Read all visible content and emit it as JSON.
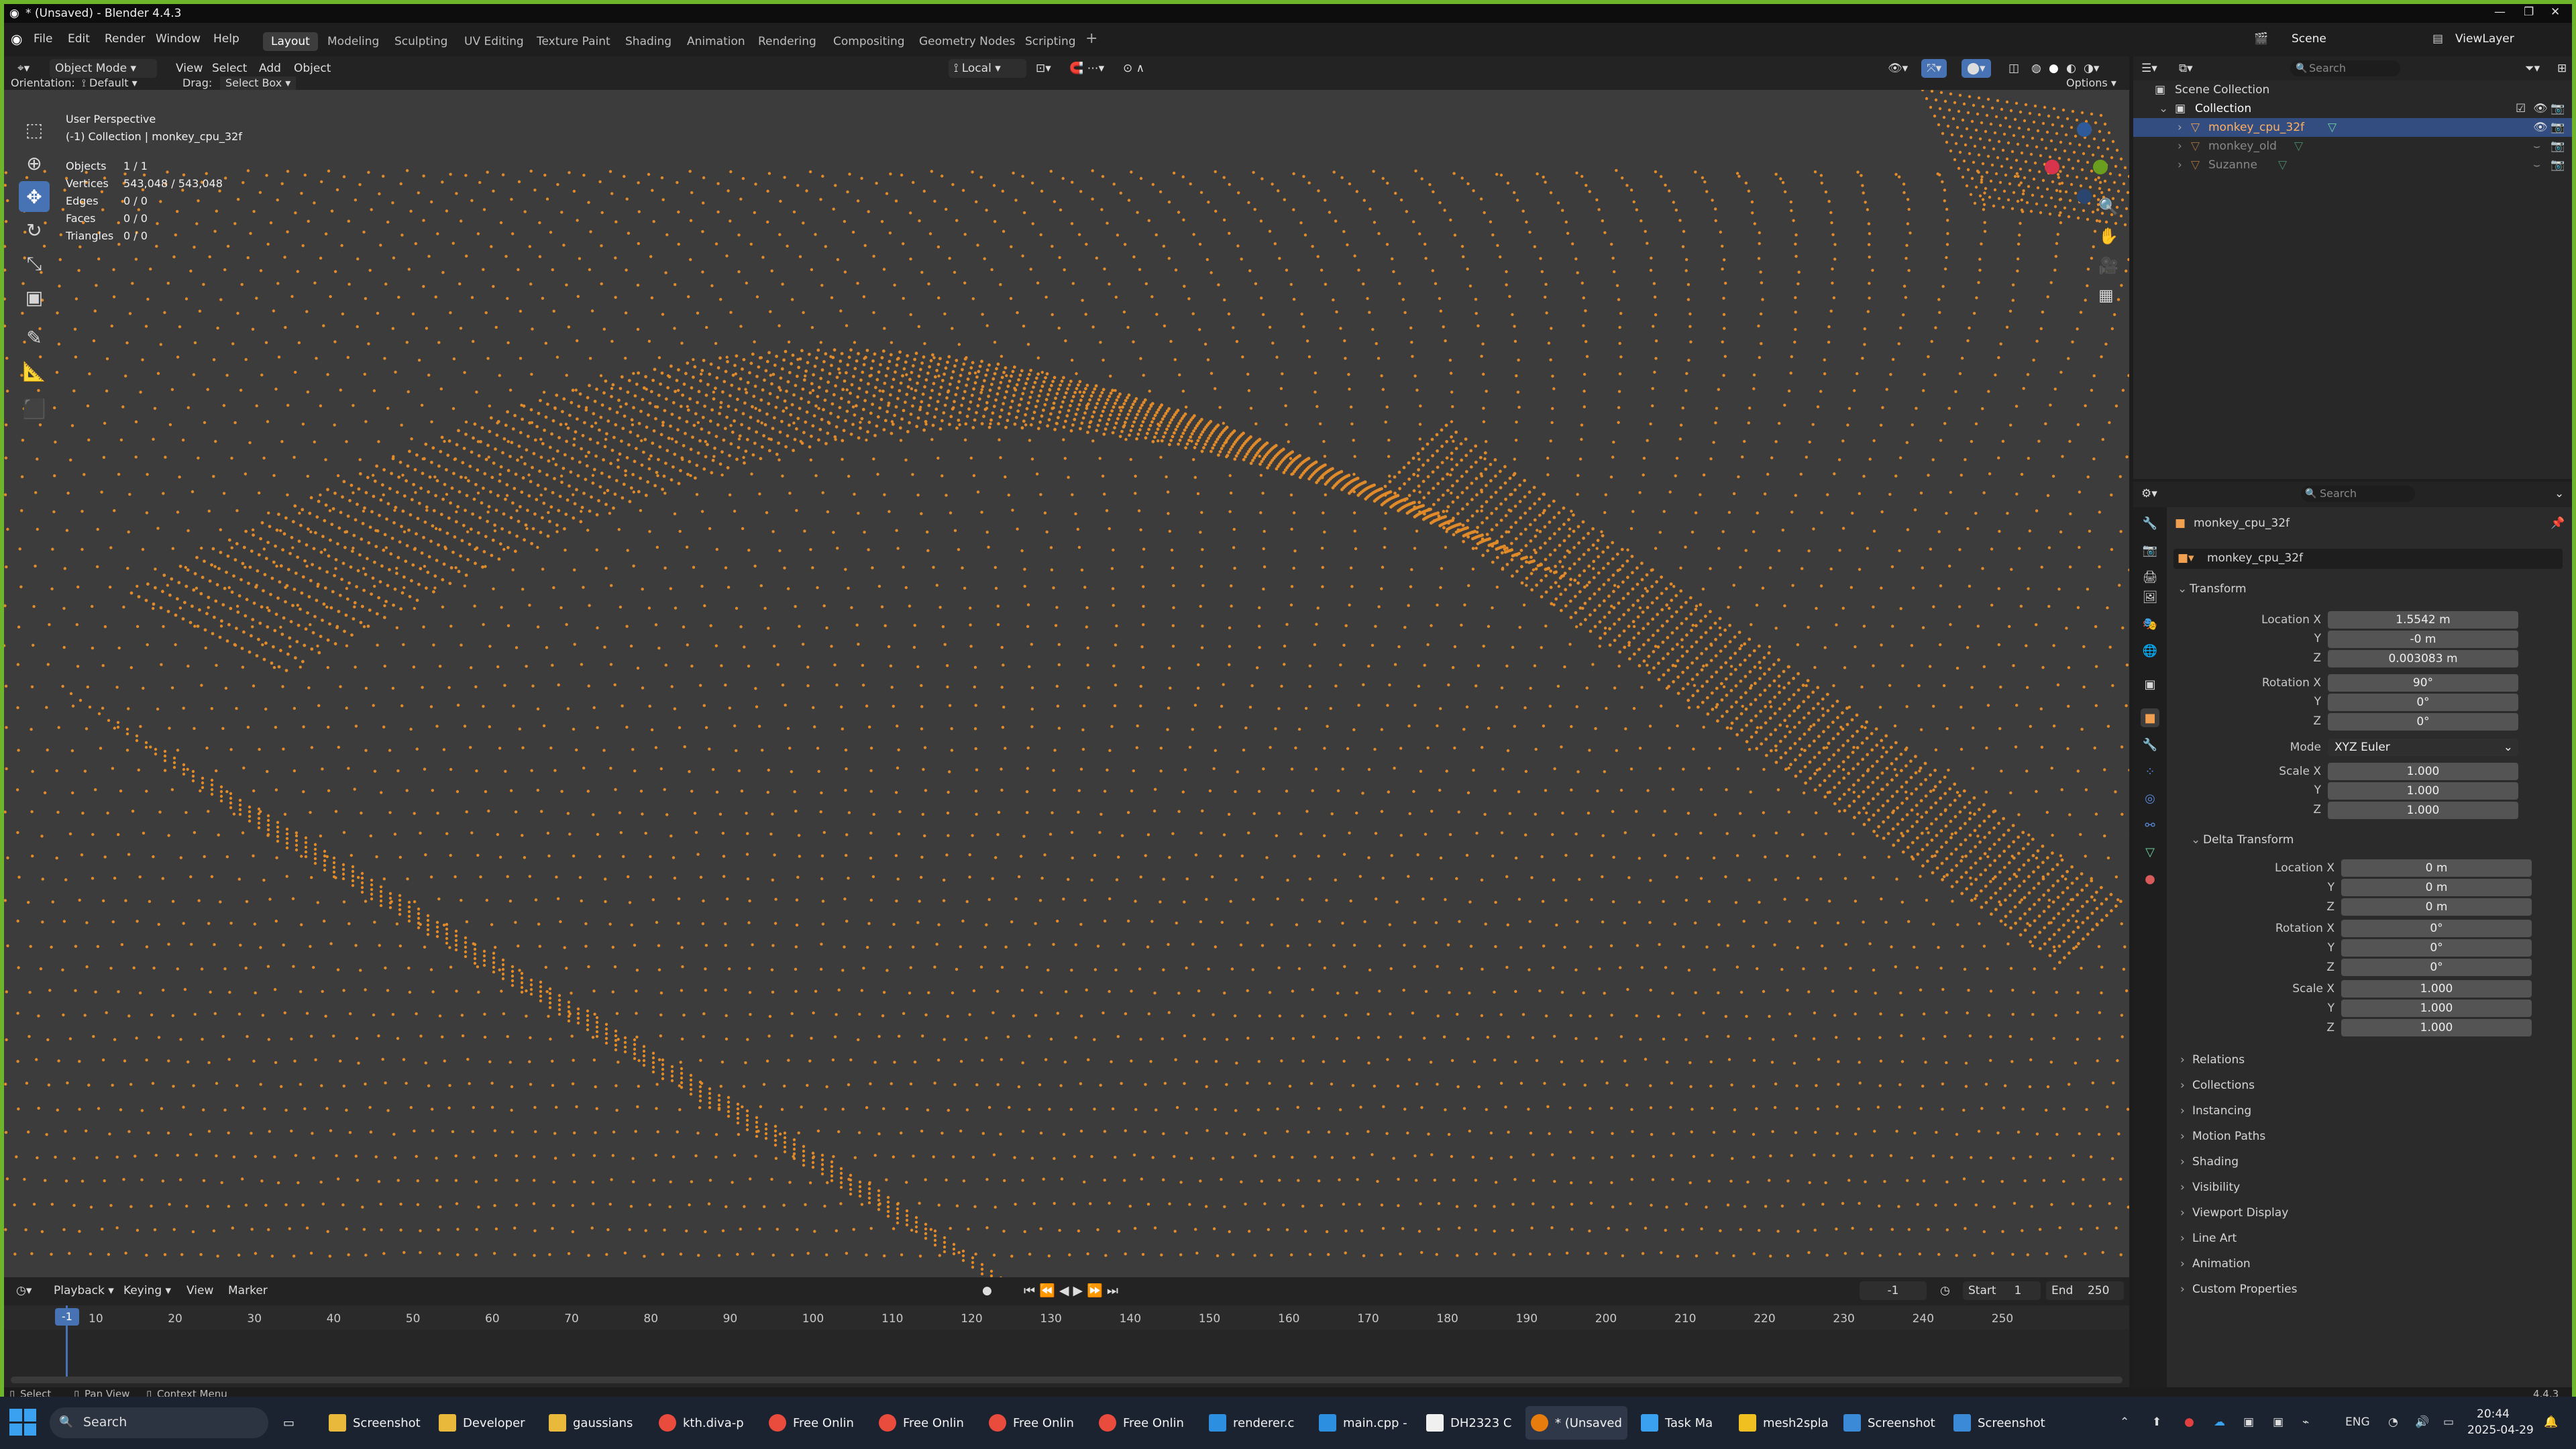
{
  "titlebar": {
    "title": "* (Unsaved) - Blender 4.4.3"
  },
  "menu": [
    "File",
    "Edit",
    "Render",
    "Window",
    "Help"
  ],
  "workspaces": [
    "Layout",
    "Modeling",
    "Sculpting",
    "UV Editing",
    "Texture Paint",
    "Shading",
    "Animation",
    "Rendering",
    "Compositing",
    "Geometry Nodes",
    "Scripting"
  ],
  "active_workspace": "Layout",
  "scene": {
    "label": "Scene",
    "viewlayer": "ViewLayer"
  },
  "viewport_header": {
    "mode": "Object Mode",
    "menus": [
      "View",
      "Select",
      "Add",
      "Object"
    ],
    "transform_orientation": "Local",
    "orientation_label": "Orientation:",
    "orientation_value": "Default",
    "drag_label": "Drag:",
    "drag_value": "Select Box",
    "options": "Options"
  },
  "viewport_info": {
    "perspective": "User Perspective",
    "collection": "(-1) Collection | monkey_cpu_32f",
    "stats": [
      {
        "label": "Objects",
        "value": "1 / 1"
      },
      {
        "label": "Vertices",
        "value": "543,048 / 543,048"
      },
      {
        "label": "Edges",
        "value": "0 / 0"
      },
      {
        "label": "Faces",
        "value": "0 / 0"
      },
      {
        "label": "Triangles",
        "value": "0 / 0"
      }
    ]
  },
  "point_color": "#e08a2a",
  "timeline": {
    "menus": [
      "Playback",
      "Keying",
      "View",
      "Marker"
    ],
    "current_frame": "-1",
    "start_label": "Start",
    "start": "1",
    "end_label": "End",
    "end": "250",
    "ticks": [
      "-1",
      "10",
      "20",
      "30",
      "40",
      "50",
      "60",
      "70",
      "80",
      "90",
      "100",
      "110",
      "120",
      "130",
      "140",
      "150",
      "160",
      "170",
      "180",
      "190",
      "200",
      "210",
      "220",
      "230",
      "240",
      "250"
    ]
  },
  "statusbar": {
    "select": "Select",
    "pan": "Pan View",
    "context": "Context Menu",
    "version": "4.4.3"
  },
  "outliner": {
    "search_placeholder": "Search",
    "scene_collection": "Scene Collection",
    "collection": "Collection",
    "objects": [
      {
        "name": "monkey_cpu_32f",
        "selected": true
      },
      {
        "name": "monkey_old",
        "selected": false
      },
      {
        "name": "Suzanne",
        "selected": false
      }
    ]
  },
  "properties": {
    "search_placeholder": "Search",
    "object_name": "monkey_cpu_32f",
    "data_name": "monkey_cpu_32f",
    "transform_title": "Transform",
    "location": {
      "label_x": "Location X",
      "x": "1.5542 m",
      "y": "-0 m",
      "z": "0.003083 m"
    },
    "rotation": {
      "label_x": "Rotation X",
      "x": "90°",
      "y": "0°",
      "z": "0°"
    },
    "mode_label": "Mode",
    "mode_value": "XYZ Euler",
    "scale": {
      "label_x": "Scale X",
      "x": "1.000",
      "y": "1.000",
      "z": "1.000"
    },
    "delta_title": "Delta Transform",
    "delta_location": {
      "x": "0 m",
      "y": "0 m",
      "z": "0 m"
    },
    "delta_rotation": {
      "x": "0°",
      "y": "0°",
      "z": "0°"
    },
    "delta_scale": {
      "x": "1.000",
      "y": "1.000",
      "z": "1.000"
    },
    "axis_y": "Y",
    "axis_z": "Z",
    "panels": [
      "Relations",
      "Collections",
      "Instancing",
      "Motion Paths",
      "Shading",
      "Visibility",
      "Viewport Display",
      "Line Art",
      "Animation",
      "Custom Properties"
    ]
  },
  "taskbar": {
    "search": "Search",
    "items": [
      "Screenshot",
      "Developer",
      "gaussians",
      "kth.diva-p",
      "Free Onlin",
      "Free Onlin",
      "Free Onlin",
      "Free Onlin",
      "renderer.c",
      "main.cpp -",
      "DH2323 C",
      "* (Unsaved",
      "Task Ma",
      "mesh2spla",
      "Screenshot",
      "Screenshot"
    ],
    "lang": "ENG",
    "time": "20:44",
    "date": "2025-04-29"
  }
}
